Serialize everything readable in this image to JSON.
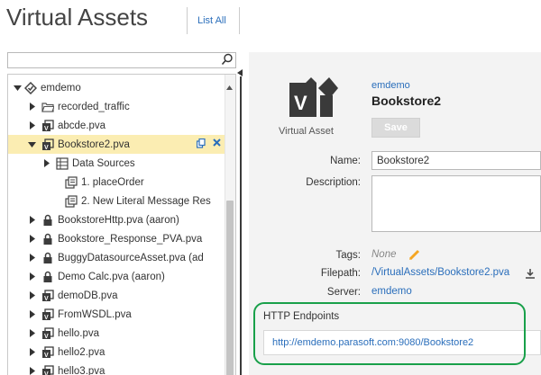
{
  "header": {
    "title": "Virtual Assets",
    "list_all": "List All"
  },
  "search": {
    "placeholder": ""
  },
  "tree": {
    "rows": [
      {
        "label": "emdemo",
        "icon": "server-icon",
        "arrow": "expanded"
      },
      {
        "label": "recorded_traffic",
        "icon": "folder-icon",
        "arrow": "collapsed"
      },
      {
        "label": "abcde.pva",
        "icon": "pva-file-icon",
        "arrow": "collapsed"
      },
      {
        "label": "Bookstore2.pva",
        "icon": "pva-file-icon",
        "arrow": "expanded",
        "selected": true
      },
      {
        "label": "Data Sources",
        "icon": "data-sources-icon",
        "arrow": "collapsed"
      },
      {
        "label": "1. placeOrder",
        "icon": "responder-icon",
        "arrow": "none"
      },
      {
        "label": "2. New Literal Message Res",
        "icon": "responder-icon",
        "arrow": "none"
      },
      {
        "label": "BookstoreHttp.pva (aaron)",
        "icon": "lock-icon",
        "arrow": "collapsed"
      },
      {
        "label": "Bookstore_Response_PVA.pva",
        "icon": "lock-icon",
        "arrow": "collapsed"
      },
      {
        "label": "BuggyDatasourceAsset.pva (ad",
        "icon": "lock-icon",
        "arrow": "collapsed"
      },
      {
        "label": "Demo Calc.pva (aaron)",
        "icon": "lock-icon",
        "arrow": "collapsed"
      },
      {
        "label": "demoDB.pva",
        "icon": "pva-file-icon",
        "arrow": "collapsed"
      },
      {
        "label": "FromWSDL.pva",
        "icon": "pva-file-icon",
        "arrow": "collapsed"
      },
      {
        "label": "hello.pva",
        "icon": "pva-file-icon",
        "arrow": "collapsed"
      },
      {
        "label": "hello2.pva",
        "icon": "pva-file-icon",
        "arrow": "collapsed"
      },
      {
        "label": "hello3.pva",
        "icon": "pva-file-icon",
        "arrow": "collapsed"
      }
    ]
  },
  "detail": {
    "logo_caption": "Virtual Asset",
    "owner": "emdemo",
    "asset_name": "Bookstore2",
    "save_label": "Save",
    "name_label": "Name:",
    "name_value": "Bookstore2",
    "description_label": "Description:",
    "tags_label": "Tags:",
    "tags_value": "None",
    "filepath_label": "Filepath:",
    "filepath_value": "/VirtualAssets/Bookstore2.pva",
    "server_label": "Server:",
    "server_value": "emdemo"
  },
  "http_endpoints": {
    "title": "HTTP Endpoints",
    "url": "http://emdemo.parasoft.com:9080/Bookstore2"
  },
  "colors": {
    "link": "#2a6ebb",
    "selected_row": "#fbedb2",
    "highlight_ring": "#19a04a",
    "edit_pencil": "#f5a623"
  }
}
